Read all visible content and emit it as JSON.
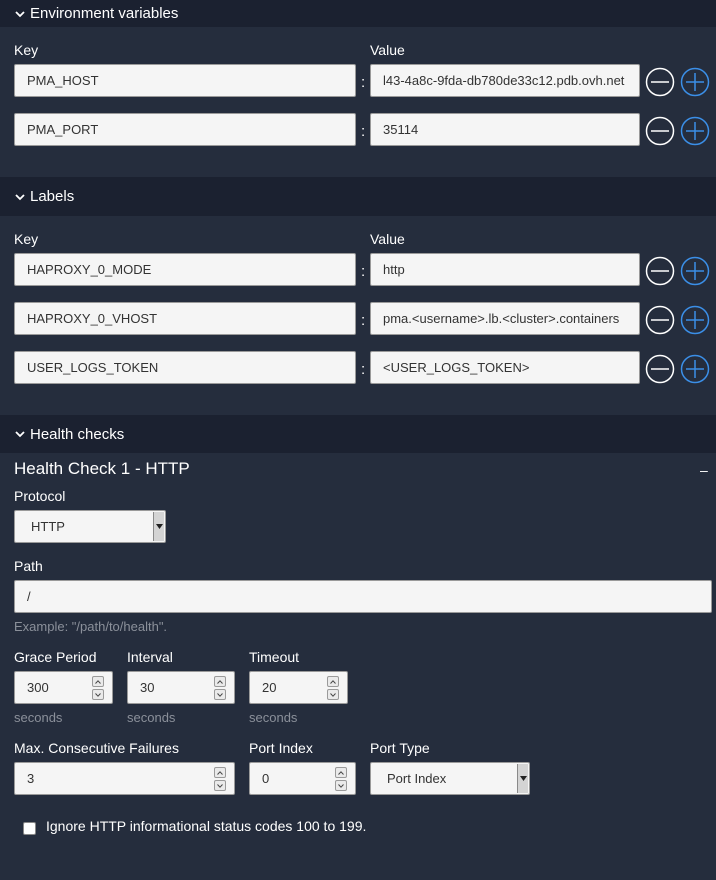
{
  "env": {
    "header": "Environment variables",
    "key_label": "Key",
    "value_label": "Value",
    "rows": [
      {
        "key": "PMA_HOST",
        "value": "l43-4a8c-9fda-db780de33c12.pdb.ovh.net"
      },
      {
        "key": "PMA_PORT",
        "value": "35114"
      }
    ]
  },
  "labels": {
    "header": "Labels",
    "key_label": "Key",
    "value_label": "Value",
    "rows": [
      {
        "key": "HAPROXY_0_MODE",
        "value": "http"
      },
      {
        "key": "HAPROXY_0_VHOST",
        "value": "pma.<username>.lb.<cluster>.containers"
      },
      {
        "key": "USER_LOGS_TOKEN",
        "value": "<USER_LOGS_TOKEN>"
      }
    ]
  },
  "health": {
    "header": "Health checks",
    "title": "Health Check 1 - HTTP",
    "collapse_symbol": "–",
    "protocol_label": "Protocol",
    "protocol_value": "HTTP",
    "path_label": "Path",
    "path_value": "/",
    "path_hint": "Example: \"/path/to/health\".",
    "grace_label": "Grace Period",
    "grace_value": "300",
    "interval_label": "Interval",
    "interval_value": "30",
    "timeout_label": "Timeout",
    "timeout_value": "20",
    "unit": "seconds",
    "failures_label": "Max. Consecutive Failures",
    "failures_value": "3",
    "port_index_label": "Port Index",
    "port_index_value": "0",
    "port_type_label": "Port Type",
    "port_type_value": "Port Index",
    "ignore_label": "Ignore HTTP informational status codes 100 to 199."
  },
  "colon": ":",
  "colors": {
    "background": "#252d3d",
    "section_header": "#1b2130",
    "add_button": "#3b8fe8",
    "remove_button": "#ffffff"
  },
  "icons": {
    "chevron": "chevron-down-icon",
    "remove": "minus-circle-icon",
    "add": "plus-circle-icon"
  }
}
